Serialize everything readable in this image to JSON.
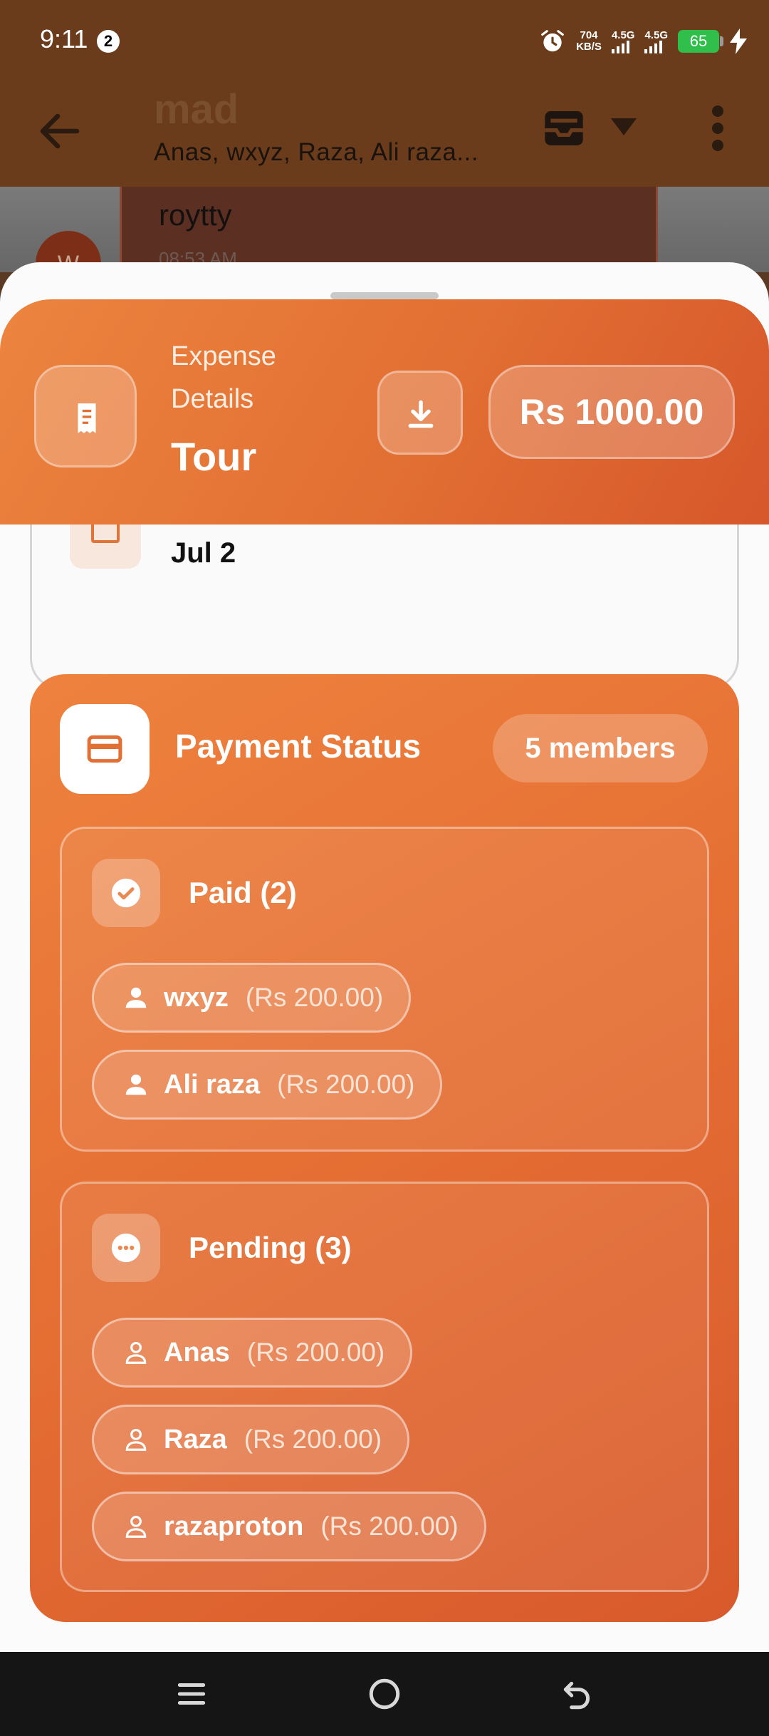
{
  "status_bar": {
    "time": "9:11",
    "notification_count": "2",
    "net_speed_value": "704",
    "net_speed_unit": "KB/S",
    "sim1_label": "4.5G",
    "sim2_label": "4.5G",
    "battery": "65"
  },
  "chat_header": {
    "title": "mad",
    "members": "Anas, wxyz, Raza, Ali raza..."
  },
  "chat_peek": {
    "message": "roytty",
    "time": "08:53 AM",
    "avatar_letter": "W"
  },
  "expense_header": {
    "label": "Expense Details",
    "title": "Tour",
    "amount": "Rs 1000.00"
  },
  "details": {
    "date": "Jul 2"
  },
  "payment_status": {
    "title": "Payment Status",
    "members_count": "5 members",
    "paid": {
      "title": "Paid (2)",
      "members": [
        {
          "name": "wxyz",
          "amount": "(Rs 200.00)"
        },
        {
          "name": "Ali raza",
          "amount": "(Rs 200.00)"
        }
      ]
    },
    "pending": {
      "title": "Pending (3)",
      "members": [
        {
          "name": "Anas",
          "amount": "(Rs 200.00)"
        },
        {
          "name": "Raza",
          "amount": "(Rs 200.00)"
        },
        {
          "name": "razaproton",
          "amount": "(Rs 200.00)"
        }
      ]
    }
  },
  "colors": {
    "brand_orange": "#e67034",
    "header_brown": "#6b3c1c",
    "battery_green": "#2fbf4a"
  },
  "icons": {
    "back": "arrow-left-icon",
    "tray": "inbox-tray-icon",
    "more": "more-vertical-icon",
    "receipt": "receipt-icon",
    "download": "download-icon",
    "card": "credit-card-icon",
    "paid": "check-circle-icon",
    "pending": "more-horizontal-circle-icon",
    "member_paid": "person-filled-icon",
    "member_pending": "person-outline-icon"
  }
}
